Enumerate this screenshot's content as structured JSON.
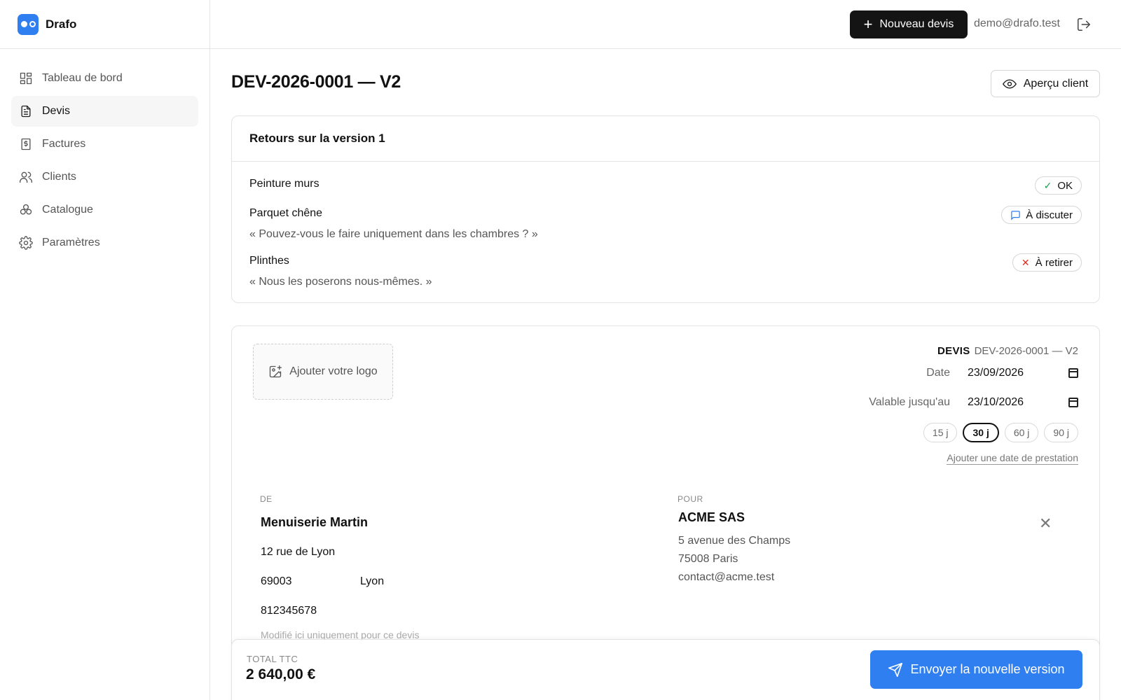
{
  "app": {
    "name": "Drafo"
  },
  "sidebar": {
    "items": [
      {
        "label": "Tableau de bord",
        "icon": "dashboard-icon"
      },
      {
        "label": "Devis",
        "icon": "document-icon",
        "active": true
      },
      {
        "label": "Factures",
        "icon": "invoice-icon"
      },
      {
        "label": "Clients",
        "icon": "users-icon"
      },
      {
        "label": "Catalogue",
        "icon": "catalog-icon"
      },
      {
        "label": "Paramètres",
        "icon": "gear-icon"
      }
    ]
  },
  "topbar": {
    "new_quote_label": "Nouveau devis",
    "user_email": "demo@drafo.test"
  },
  "page": {
    "title": "DEV-2026-0001 — V2",
    "preview_label": "Aperçu client"
  },
  "feedback": {
    "title": "Retours sur la version 1",
    "items": [
      {
        "name": "Peinture murs",
        "status": "OK",
        "comment": ""
      },
      {
        "name": "Parquet chêne",
        "status": "À discuter",
        "comment": "« Pouvez-vous le faire uniquement dans les chambres ? »"
      },
      {
        "name": "Plinthes",
        "status": "À retirer",
        "comment": "« Nous les poserons nous-mêmes. »"
      }
    ]
  },
  "quote": {
    "logo_label": "Ajouter votre logo",
    "type_label": "DEVIS",
    "number": "DEV-2026-0001 — V2",
    "date_label": "Date",
    "date_value": "23/09/2026",
    "valid_label": "Valable jusqu'au",
    "valid_value": "23/10/2026",
    "durations": [
      "15 j",
      "30 j",
      "60 j",
      "90 j"
    ],
    "selected_duration": "30 j",
    "add_service_date": "Ajouter une date de prestation",
    "from": {
      "label": "DE",
      "name": "Menuiserie Martin",
      "street": "12 rue de Lyon",
      "zip": "69003",
      "city": "Lyon",
      "siren": "812345678"
    },
    "to": {
      "label": "POUR",
      "name": "ACME SAS",
      "street": "5 avenue des Champs",
      "city_line": "75008 Paris",
      "email": "contact@acme.test"
    },
    "faded_note": "Modifié ici uniquement pour ce devis"
  },
  "footer": {
    "total_label": "TOTAL TTC",
    "total_value": "2 640,00 €",
    "send_label": "Envoyer la nouvelle version"
  },
  "colors": {
    "accent": "#2f7ff0",
    "dark_button": "#141414",
    "ok": "#1f9d55",
    "discuss": "#2f7ff0",
    "remove": "#d93025"
  }
}
